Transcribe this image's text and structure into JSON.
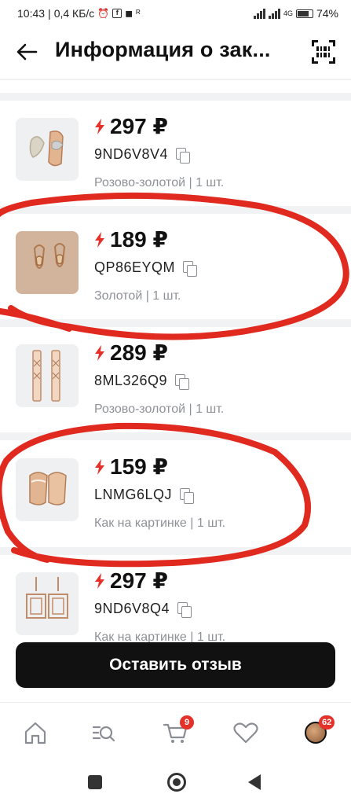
{
  "status_bar": {
    "time": "10:43",
    "speed": "0,4 КБ/с",
    "battery": "74%",
    "network": "4G"
  },
  "header": {
    "title": "Информация о зак..."
  },
  "items": [
    {
      "price": "297 ₽",
      "code": "9ND6V8V4",
      "variant": "Розово-золотой | 1 шт."
    },
    {
      "price": "189 ₽",
      "code": "QP86EYQM",
      "variant": "Золотой | 1 шт."
    },
    {
      "price": "289 ₽",
      "code": "8ML326Q9",
      "variant": "Розово-золотой | 1 шт."
    },
    {
      "price": "159 ₽",
      "code": "LNMG6LQJ",
      "variant": "Как на картинке | 1 шт."
    },
    {
      "price": "297 ₽",
      "code": "9ND6V8Q4",
      "variant": "Как на картинке | 1 шт."
    }
  ],
  "cta": {
    "label": "Оставить отзыв"
  },
  "bottom_nav": {
    "cart_badge": "9",
    "profile_badge": "62"
  },
  "colors": {
    "accent": "#e4322b",
    "button": "#111111",
    "muted": "#8e9196",
    "marker": "#e02a1f"
  }
}
